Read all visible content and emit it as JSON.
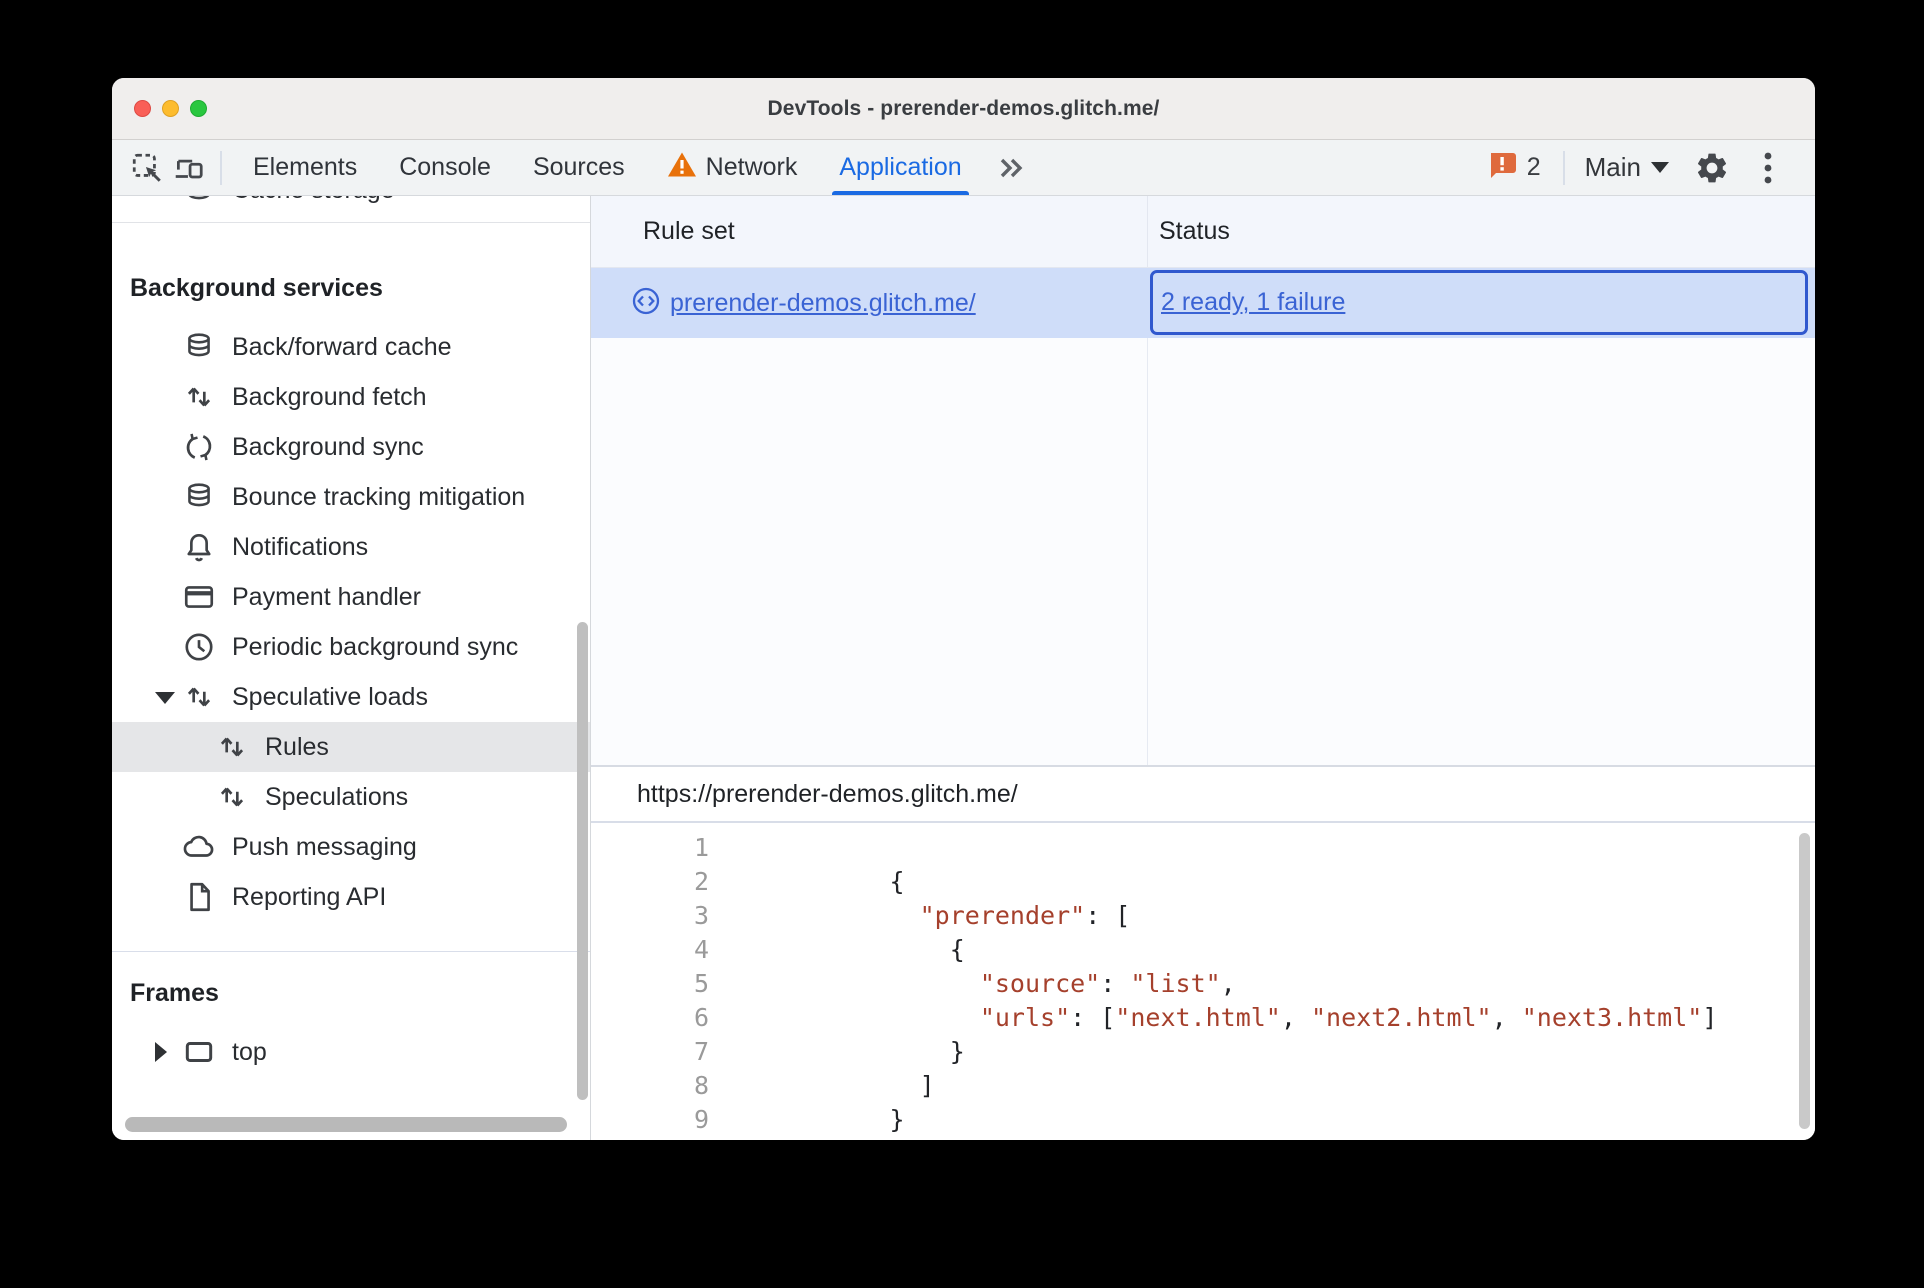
{
  "window": {
    "title": "DevTools - prerender-demos.glitch.me/"
  },
  "toolbar": {
    "tabs": {
      "elements": "Elements",
      "console": "Console",
      "sources": "Sources",
      "network": "Network",
      "application": "Application"
    },
    "more_tabs_glyph": "»",
    "issue_count": "2",
    "target_selector_label": "Main"
  },
  "sidebar": {
    "clipped_item": "Cache storage",
    "section_background_services": "Background services",
    "items": [
      {
        "label": "Back/forward cache",
        "icon": "database-icon"
      },
      {
        "label": "Background fetch",
        "icon": "up-down-arrows-icon"
      },
      {
        "label": "Background sync",
        "icon": "sync-arrows-icon"
      },
      {
        "label": "Bounce tracking mitigation",
        "icon": "database-icon"
      },
      {
        "label": "Notifications",
        "icon": "bell-icon"
      },
      {
        "label": "Payment handler",
        "icon": "credit-card-icon"
      },
      {
        "label": "Periodic background sync",
        "icon": "clock-icon"
      },
      {
        "label": "Speculative loads",
        "icon": "up-down-arrows-icon",
        "expanded": true
      },
      {
        "label": "Rules",
        "icon": "up-down-arrows-icon",
        "selected": true
      },
      {
        "label": "Speculations",
        "icon": "up-down-arrows-icon"
      },
      {
        "label": "Push messaging",
        "icon": "cloud-icon"
      },
      {
        "label": "Reporting API",
        "icon": "document-icon"
      }
    ],
    "section_frames": "Frames",
    "frame_item": "top"
  },
  "table": {
    "columns": {
      "rule_set": "Rule set",
      "status": "Status"
    },
    "row": {
      "rule_set": "prerender-demos.glitch.me/",
      "status": "2 ready, 1 failure"
    }
  },
  "preview": {
    "url": "https://prerender-demos.glitch.me/",
    "code_lines": [
      {
        "num": "1",
        "tokens": []
      },
      {
        "num": "2",
        "tokens": [
          {
            "c": "p",
            "text": "          {"
          }
        ]
      },
      {
        "num": "3",
        "tokens": [
          {
            "c": "p",
            "text": "            "
          },
          {
            "c": "s",
            "text": "\"prerender\""
          },
          {
            "c": "p",
            "text": ": ["
          }
        ]
      },
      {
        "num": "4",
        "tokens": [
          {
            "c": "p",
            "text": "              {"
          }
        ]
      },
      {
        "num": "5",
        "tokens": [
          {
            "c": "p",
            "text": "                "
          },
          {
            "c": "s",
            "text": "\"source\""
          },
          {
            "c": "p",
            "text": ": "
          },
          {
            "c": "s",
            "text": "\"list\""
          },
          {
            "c": "p",
            "text": ","
          }
        ]
      },
      {
        "num": "6",
        "tokens": [
          {
            "c": "p",
            "text": "                "
          },
          {
            "c": "s",
            "text": "\"urls\""
          },
          {
            "c": "p",
            "text": ": ["
          },
          {
            "c": "s",
            "text": "\"next.html\""
          },
          {
            "c": "p",
            "text": ", "
          },
          {
            "c": "s",
            "text": "\"next2.html\""
          },
          {
            "c": "p",
            "text": ", "
          },
          {
            "c": "s",
            "text": "\"next3.html\""
          },
          {
            "c": "p",
            "text": "]"
          }
        ]
      },
      {
        "num": "7",
        "tokens": [
          {
            "c": "p",
            "text": "              }"
          }
        ]
      },
      {
        "num": "8",
        "tokens": [
          {
            "c": "p",
            "text": "            ]"
          }
        ]
      },
      {
        "num": "9",
        "tokens": [
          {
            "c": "p",
            "text": "          }"
          }
        ]
      }
    ]
  },
  "colors": {
    "tab_accent_blue": "#1a6ae3",
    "link_blue": "#3a63d4",
    "focus_ring_blue": "#3058ce",
    "selected_row_blue": "#cfddf9",
    "warning_orange": "#e8710a",
    "issue_badge_orange": "#df6a3d",
    "json_string_red": "#a5402c",
    "sidebar_selection_gray": "#e5e6e8"
  }
}
